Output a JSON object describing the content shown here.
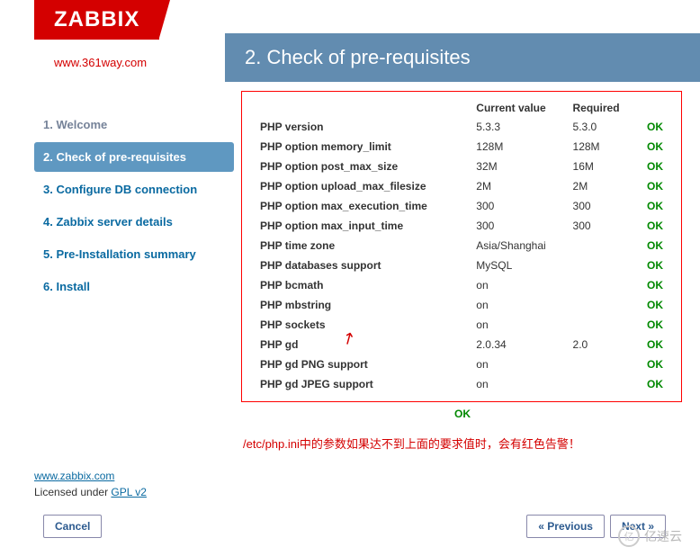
{
  "logo": "ZABBIX",
  "watermark": "www.361way.com",
  "page_title": "2. Check of pre-requisites",
  "steps": {
    "s1": "1. Welcome",
    "s2": "2. Check of pre-requisites",
    "s3": "3. Configure DB connection",
    "s4": "4. Zabbix server details",
    "s5": "5. Pre-Installation summary",
    "s6": "6. Install"
  },
  "table": {
    "h_current": "Current value",
    "h_required": "Required",
    "rows": [
      {
        "name": "PHP version",
        "cur": "5.3.3",
        "req": "5.3.0",
        "status": "OK"
      },
      {
        "name": "PHP option memory_limit",
        "cur": "128M",
        "req": "128M",
        "status": "OK"
      },
      {
        "name": "PHP option post_max_size",
        "cur": "32M",
        "req": "16M",
        "status": "OK"
      },
      {
        "name": "PHP option upload_max_filesize",
        "cur": "2M",
        "req": "2M",
        "status": "OK"
      },
      {
        "name": "PHP option max_execution_time",
        "cur": "300",
        "req": "300",
        "status": "OK"
      },
      {
        "name": "PHP option max_input_time",
        "cur": "300",
        "req": "300",
        "status": "OK"
      },
      {
        "name": "PHP time zone",
        "cur": "Asia/Shanghai",
        "req": "",
        "status": "OK"
      },
      {
        "name": "PHP databases support",
        "cur": "MySQL",
        "req": "",
        "status": "OK"
      },
      {
        "name": "PHP bcmath",
        "cur": "on",
        "req": "",
        "status": "OK"
      },
      {
        "name": "PHP mbstring",
        "cur": "on",
        "req": "",
        "status": "OK"
      },
      {
        "name": "PHP sockets",
        "cur": "on",
        "req": "",
        "status": "OK"
      },
      {
        "name": "PHP gd",
        "cur": "2.0.34",
        "req": "2.0",
        "status": "OK"
      },
      {
        "name": "PHP gd PNG support",
        "cur": "on",
        "req": "",
        "status": "OK"
      },
      {
        "name": "PHP gd JPEG support",
        "cur": "on",
        "req": "",
        "status": "OK"
      }
    ],
    "overall_ok": "OK"
  },
  "note": "/etc/php.ini中的参数如果达不到上面的要求值时，会有红色告警！",
  "footer": {
    "site": "www.zabbix.com",
    "license_pre": "Licensed under ",
    "license_link": "GPL v2"
  },
  "buttons": {
    "cancel": "Cancel",
    "prev": "« Previous",
    "next": "Next »"
  },
  "yisu": "亿速云"
}
